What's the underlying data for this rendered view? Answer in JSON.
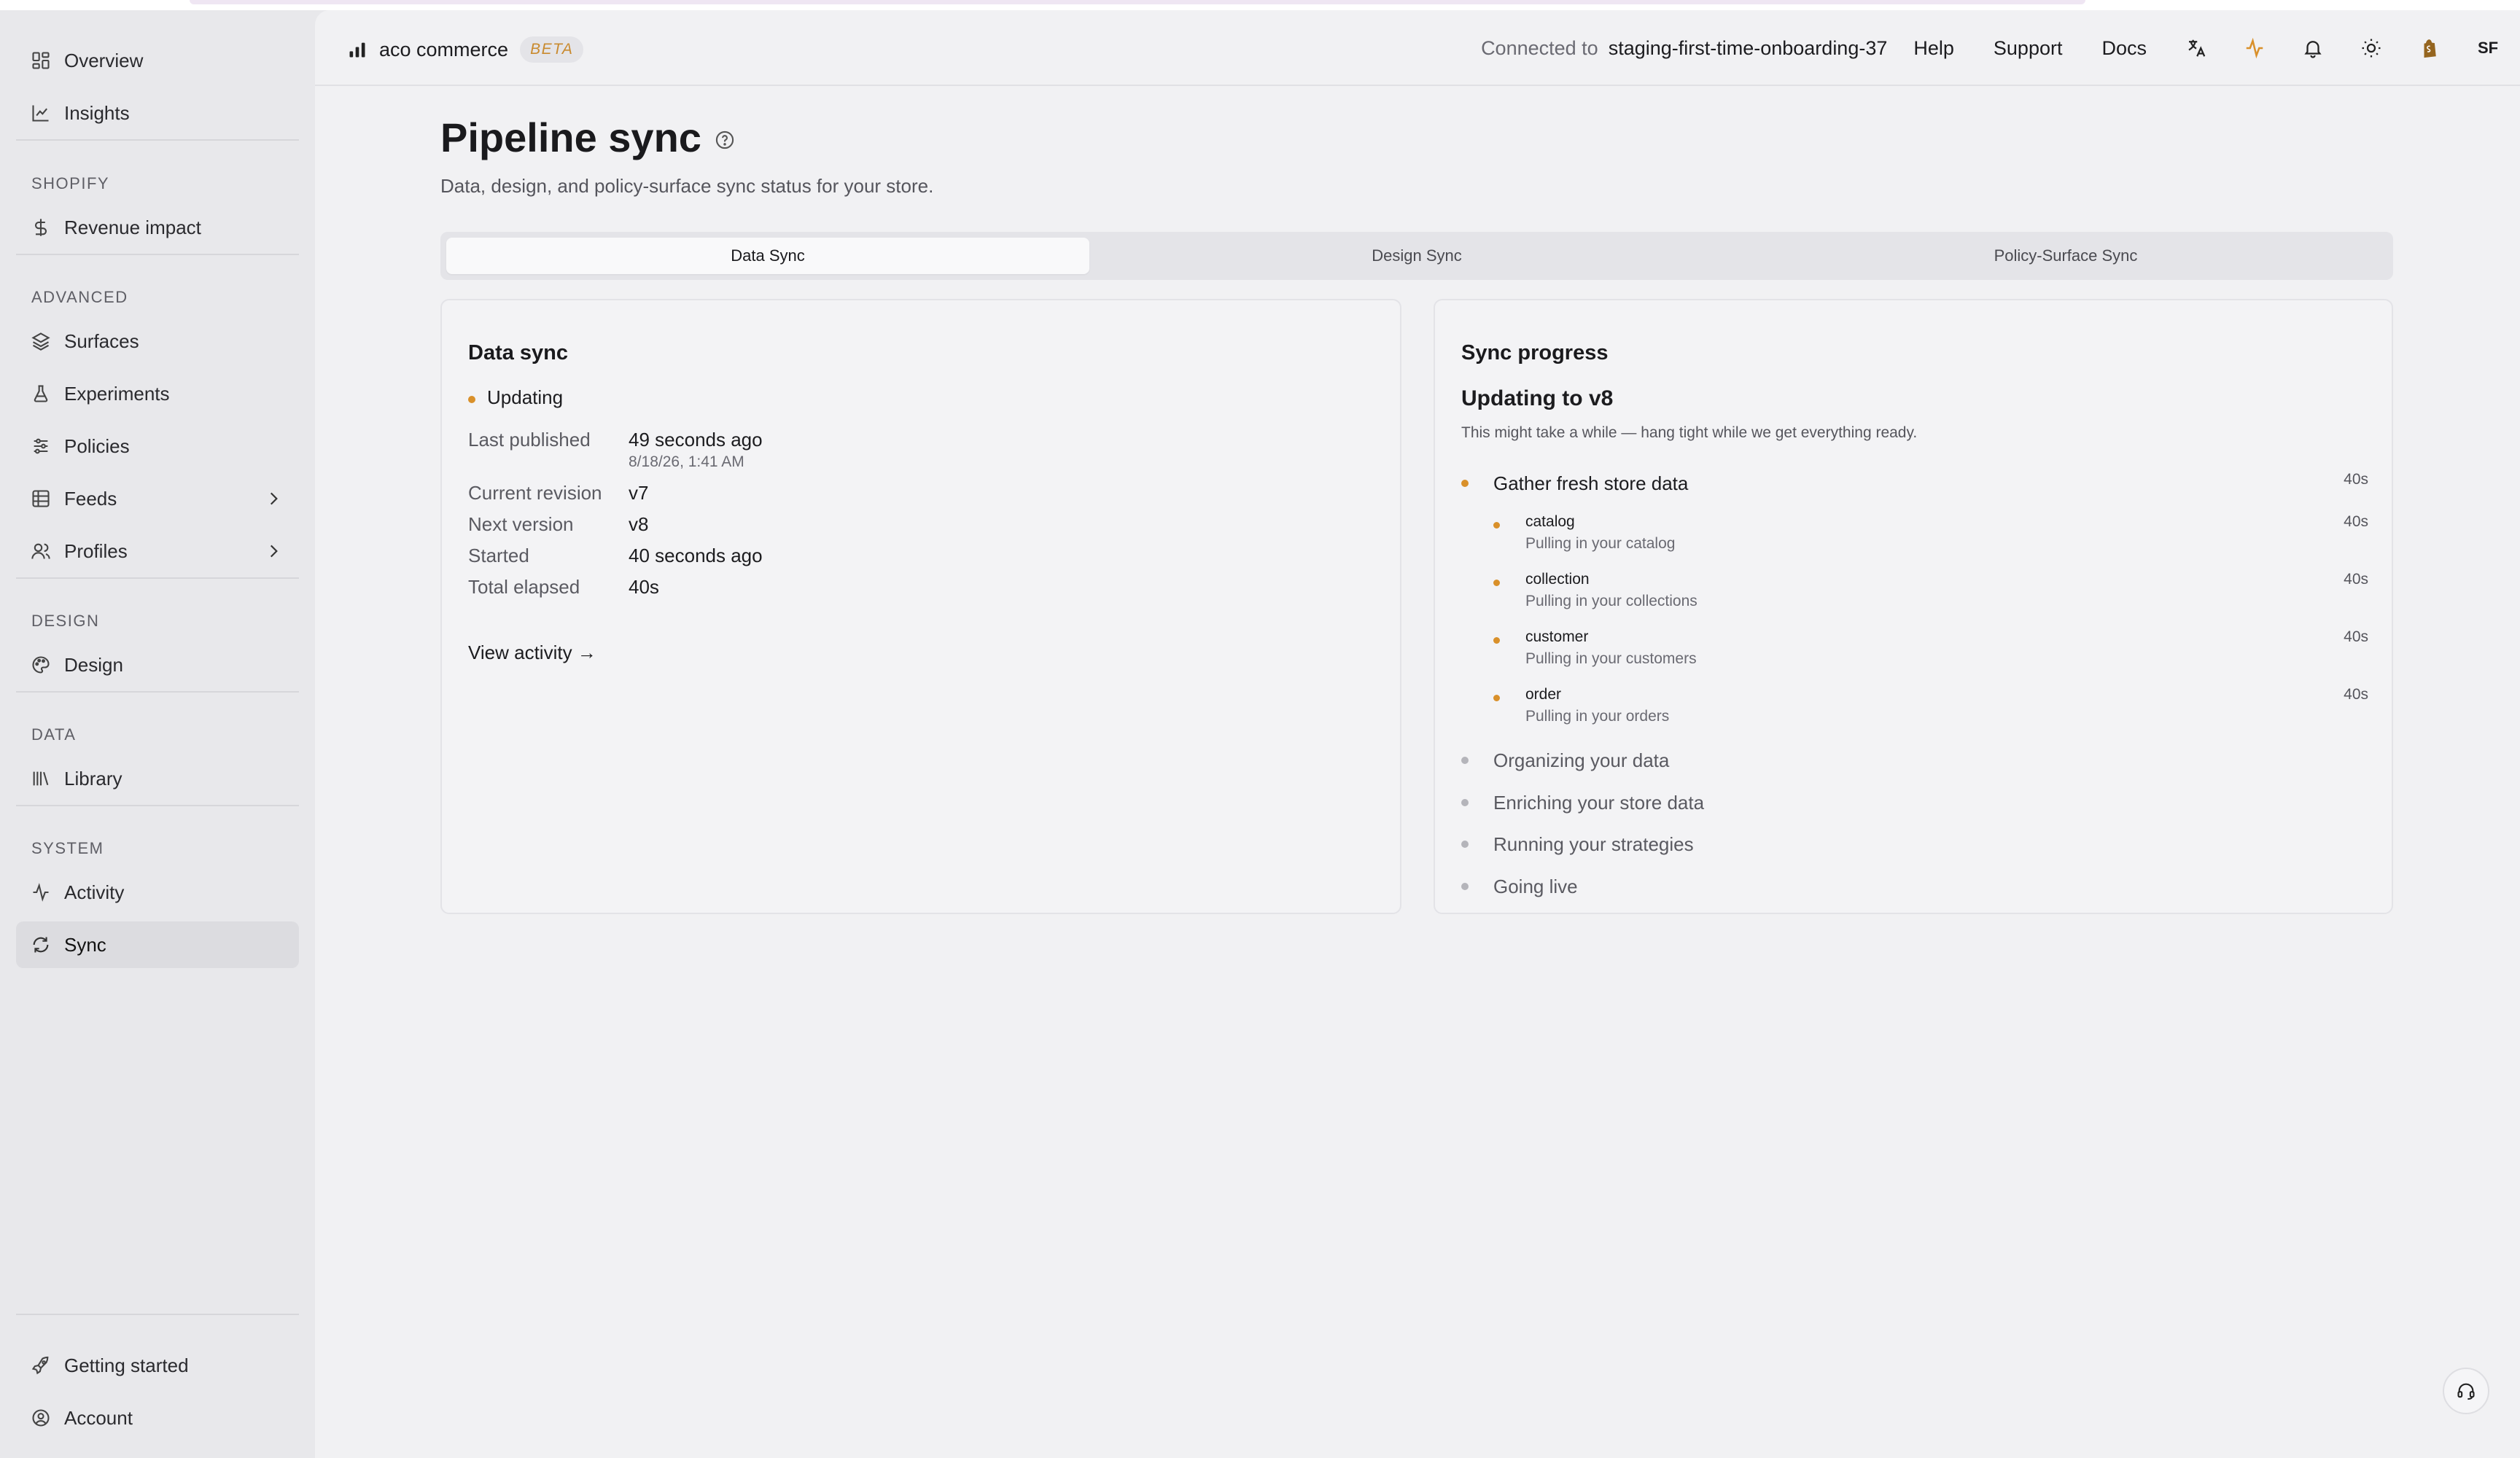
{
  "sidebar": {
    "items": [
      {
        "label": "Overview",
        "icon": "grid-icon"
      },
      {
        "label": "Insights",
        "icon": "line-chart-icon"
      },
      {
        "label": "Revenue impact",
        "icon": "dollar-icon"
      },
      {
        "label": "Surfaces",
        "icon": "layers-icon"
      },
      {
        "label": "Experiments",
        "icon": "flask-icon"
      },
      {
        "label": "Policies",
        "icon": "sliders-icon"
      },
      {
        "label": "Feeds",
        "icon": "table-icon"
      },
      {
        "label": "Profiles",
        "icon": "users-icon"
      },
      {
        "label": "Design",
        "icon": "palette-icon"
      },
      {
        "label": "Library",
        "icon": "library-icon"
      },
      {
        "label": "Activity",
        "icon": "activity-icon"
      },
      {
        "label": "Sync",
        "icon": "sync-icon",
        "active": true
      },
      {
        "label": "Getting started",
        "icon": "rocket-icon"
      },
      {
        "label": "Account",
        "icon": "account-icon"
      }
    ],
    "sections": {
      "shopify": "SHOPIFY",
      "advanced": "ADVANCED",
      "design": "DESIGN",
      "data": "DATA",
      "system": "SYSTEM"
    }
  },
  "topbar": {
    "brand": "aco commerce",
    "badge": "BETA",
    "connected_label": "Connected to",
    "connected_value": "staging-first-time-onboarding-37",
    "links": [
      "Help",
      "Support",
      "Docs"
    ],
    "avatar": "SF"
  },
  "page": {
    "title": "Pipeline sync",
    "subtitle": "Data, design, and policy-surface sync status for your store."
  },
  "tabs": [
    "Data Sync",
    "Design Sync",
    "Policy-Surface Sync"
  ],
  "data_sync": {
    "title": "Data sync",
    "status": "Updating",
    "fields": {
      "last_published_label": "Last published",
      "last_published_value": "49 seconds ago",
      "last_published_sub": "8/18/26, 1:41 AM",
      "current_revision_label": "Current revision",
      "current_revision_value": "v7",
      "next_version_label": "Next version",
      "next_version_value": "v8",
      "started_label": "Started",
      "started_value": "40 seconds ago",
      "total_elapsed_label": "Total elapsed",
      "total_elapsed_value": "40s"
    },
    "link": "View activity →"
  },
  "sync_progress": {
    "title": "Sync progress",
    "heading": "Updating to v8",
    "description": "This might take a while — hang tight while we get everything ready.",
    "steps": [
      {
        "label": "Gather fresh store data",
        "duration": "40s"
      },
      {
        "label": "Organizing your data"
      },
      {
        "label": "Enriching your store data"
      },
      {
        "label": "Running your strategies"
      },
      {
        "label": "Going live"
      }
    ],
    "substeps": [
      {
        "name": "catalog",
        "desc": "Pulling in your catalog",
        "duration": "40s"
      },
      {
        "name": "collection",
        "desc": "Pulling in your collections",
        "duration": "40s"
      },
      {
        "name": "customer",
        "desc": "Pulling in your customers",
        "duration": "40s"
      },
      {
        "name": "order",
        "desc": "Pulling in your orders",
        "duration": "40s"
      }
    ]
  },
  "colors": {
    "accent": "#d9902a",
    "pending": "#b4b4ba",
    "background": "#f1f1f3",
    "sidebar": "#e8e8eb"
  }
}
